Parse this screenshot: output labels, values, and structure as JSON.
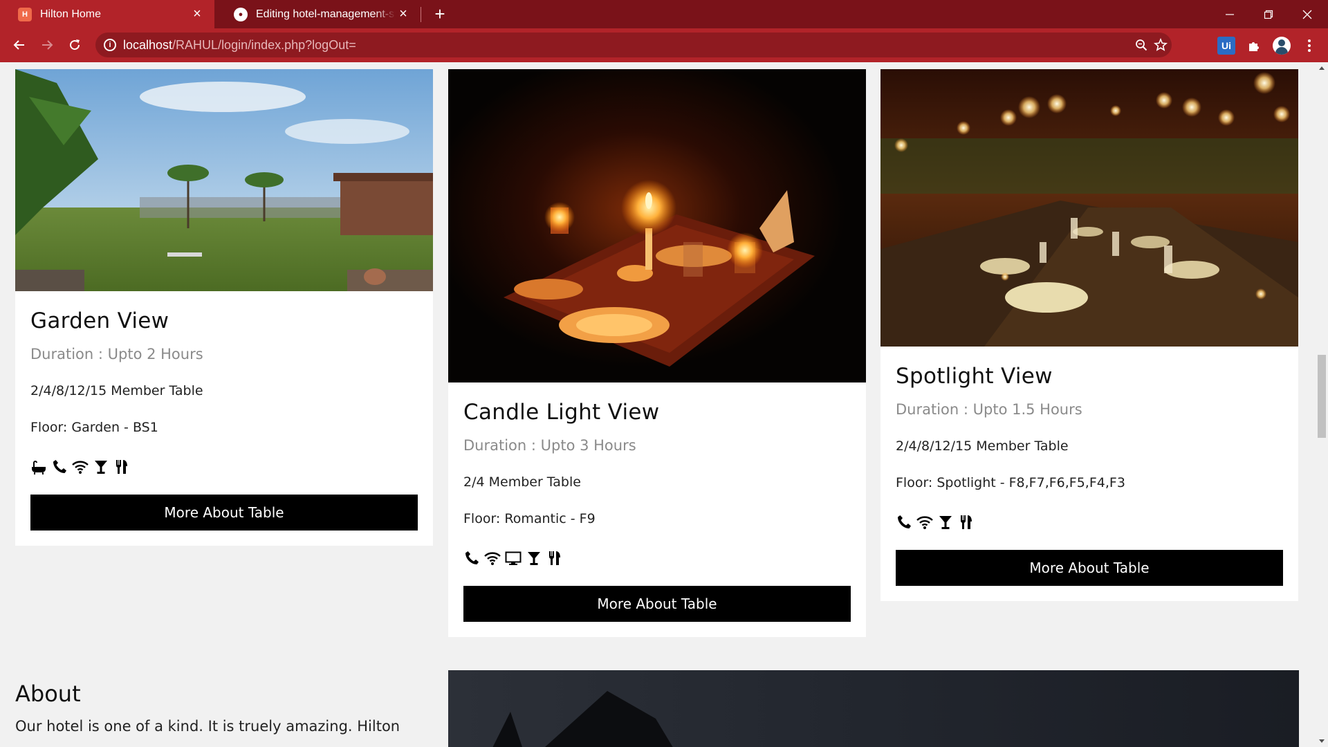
{
  "browser": {
    "tabs": [
      {
        "title": "Hilton Home",
        "favicon": "hilton-icon",
        "active": true
      },
      {
        "title": "Editing hotel-management-system",
        "favicon": "github-icon",
        "active": false
      }
    ],
    "url_host": "localhost",
    "url_path": "/RAHUL/login/index.php?logOut=",
    "accent_color": "#b22329",
    "tabbar_color": "#7a1219"
  },
  "cards": [
    {
      "title": "Garden View",
      "duration": "Duration : Upto 2 Hours",
      "capacity": "2/4/8/12/15 Member Table",
      "floor": "Floor: Garden - BS1",
      "amenities": [
        "bath-icon",
        "phone-icon",
        "wifi-icon",
        "cocktail-icon",
        "cutlery-icon"
      ],
      "button": "More About Table"
    },
    {
      "title": "Candle Light View",
      "duration": "Duration : Upto 3 Hours",
      "capacity": "2/4 Member Table",
      "floor": "Floor: Romantic - F9",
      "amenities": [
        "phone-icon",
        "wifi-icon",
        "tv-icon",
        "cocktail-icon",
        "cutlery-icon"
      ],
      "button": "More About Table"
    },
    {
      "title": "Spotlight View",
      "duration": "Duration : Upto 1.5 Hours",
      "capacity": "2/4/8/12/15 Member Table",
      "floor": "Floor: Spotlight - F8,F7,F6,F5,F4,F3",
      "amenities": [
        "phone-icon",
        "wifi-icon",
        "cocktail-icon",
        "cutlery-icon"
      ],
      "button": "More About Table"
    }
  ],
  "about": {
    "title": "About",
    "text": "Our hotel is one of a kind. It is truely amazing. Hilton"
  }
}
